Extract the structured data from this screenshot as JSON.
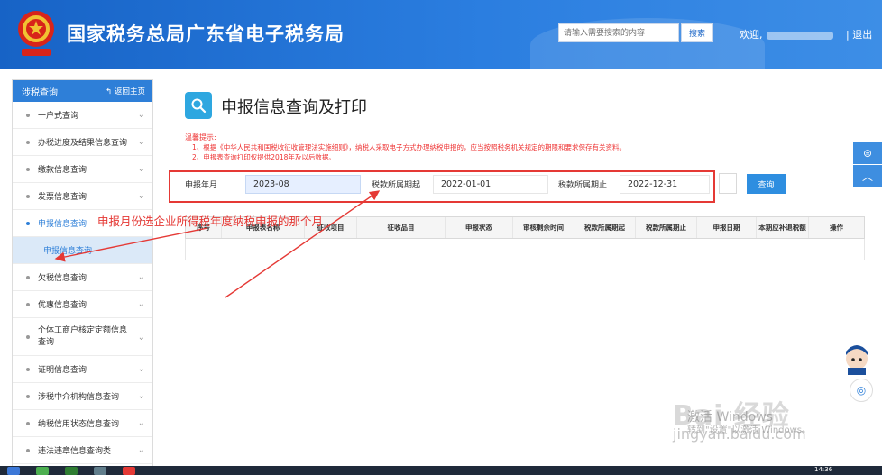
{
  "header": {
    "site_title": "国家税务总局广东省电子税务局",
    "search_placeholder": "请输入需要搜索的内容",
    "search_button": "搜索",
    "welcome": "欢迎,",
    "logout": "| 退出"
  },
  "sidebar": {
    "heading": "涉税查询",
    "home_link": "返回主页",
    "items": [
      {
        "label": "一户式查询"
      },
      {
        "label": "办税进度及结果信息查询"
      },
      {
        "label": "缴款信息查询"
      },
      {
        "label": "发票信息查询"
      },
      {
        "label": "申报信息查询"
      },
      {
        "label": "欠税信息查询"
      },
      {
        "label": "优惠信息查询"
      },
      {
        "label": "个体工商户核定定额信息查询"
      },
      {
        "label": "证明信息查询"
      },
      {
        "label": "涉税中介机构信息查询"
      },
      {
        "label": "纳税信用状态信息查询"
      },
      {
        "label": "违法违章信息查询类"
      }
    ],
    "sub_item": "申报信息查询"
  },
  "main": {
    "title": "申报信息查询及打印",
    "tip_title": "温馨提示:",
    "tip_1": "1、根据《中华人民共和国税收征收管理法实施细则》，纳税人采取电子方式办理纳税申报的，应当按照税务机关规定的期限和要求保存有关资料。",
    "tip_2": "2、申报表查询打印仅提供2018年及以后数据。",
    "form": {
      "period_label": "申报年月",
      "period_value": "2023-08",
      "start_label": "税款所属期起",
      "start_value": "2022-01-01",
      "end_label": "税款所属期止",
      "end_value": "2022-12-31",
      "query_button": "查询"
    },
    "table_headers": [
      "序号",
      "申报表名称",
      "征收项目",
      "征收品目",
      "申报状态",
      "审核剩余时间",
      "税款所属期起",
      "税款所属期止",
      "申报日期",
      "本期应补退税额",
      "操作"
    ]
  },
  "annotation": "申报月份选企业所得税年度纳税申报的那个月",
  "watermark": {
    "baidu": "Bai 经验",
    "url": "jingyan.baidu.com",
    "activate": "激活 Windows",
    "activate_hint": "转到\"设置\"以激活 Windows。"
  },
  "taskbar": {
    "time": "14:36"
  },
  "colors": {
    "header": "#1763c6",
    "accent": "#2e7fd8",
    "annotation": "#e53935"
  }
}
